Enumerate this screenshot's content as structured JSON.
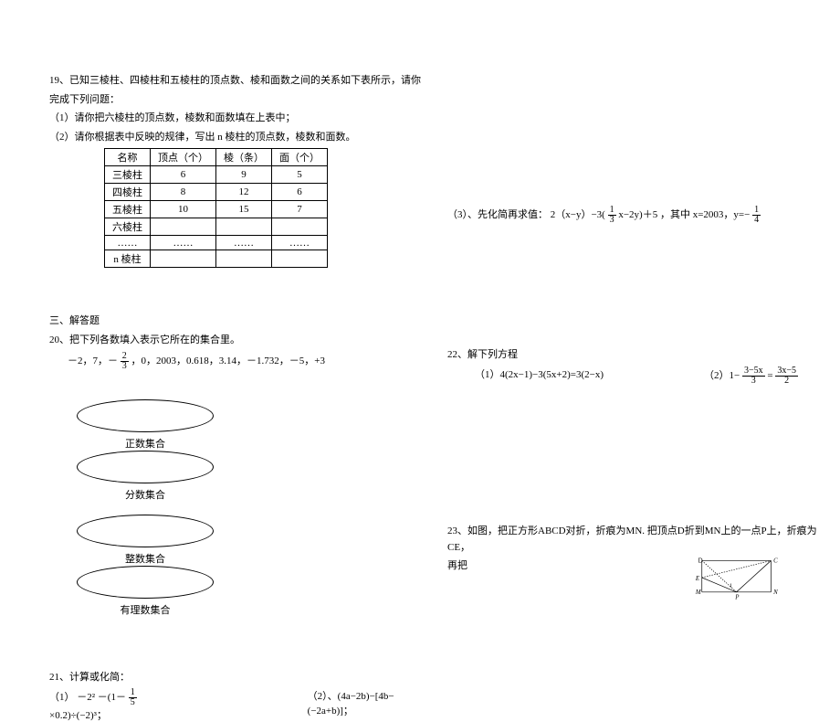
{
  "q19": {
    "title": "19、已知三棱柱、四棱柱和五棱柱的顶点数、棱和面数之间的关系如下表所示，请你",
    "title_line2": "完成下列问题：",
    "sub1": "（1）请你把六棱柱的顶点数，棱数和面数填在上表中；",
    "sub2": "（2）请你根据表中反映的规律，写出 n 棱柱的顶点数，棱数和面数。",
    "table": {
      "headers": [
        "名称",
        "顶点（个）",
        "棱（条）",
        "面（个）"
      ],
      "rows": [
        [
          "三棱柱",
          "6",
          "9",
          "5"
        ],
        [
          "四棱柱",
          "8",
          "12",
          "6"
        ],
        [
          "五棱柱",
          "10",
          "15",
          "7"
        ],
        [
          "六棱柱",
          "",
          "",
          ""
        ],
        [
          "……",
          "……",
          "……",
          "……"
        ],
        [
          "n 棱柱",
          "",
          "",
          ""
        ]
      ]
    }
  },
  "section3": {
    "title": "三、解答题"
  },
  "q20": {
    "title": "20、把下列各数填入表示它所在的集合里。",
    "numbers_prefix": "－2，7，－",
    "numbers_suffix": "，0，2003，0.618，3.14，－1.732，－5，+3",
    "frac_num": "2",
    "frac_den": "3",
    "sets": {
      "pos": "正数集合",
      "frac": "分数集合",
      "int": "整数集合",
      "rat": "有理数集合"
    }
  },
  "q21": {
    "title": "21、计算或化简：",
    "part1": "（1）",
    "part1_expr_before": "－2² －(1－",
    "part1_frac_num": "1",
    "part1_frac_den": "5",
    "part1_expr_after": "×0.2)÷(−2)³；",
    "part2": "（2）、(4a−2b)−[4b−(−2a+b)]；"
  },
  "q3sub": {
    "prefix": "（3）、先化简再求值：  2（x−y）−3(",
    "frac_num": "1",
    "frac_den": "3",
    "middle": "x−2y)＋5  ，其中 x=2003，y=−",
    "frac2_num": "1",
    "frac2_den": "4"
  },
  "q22": {
    "title": "22、解下列方程",
    "part1": "（1）4(2x−1)−3(5x+2)=3(2−x)",
    "part2_prefix": "（2）1−",
    "part2_frac1_num": "3−5x",
    "part2_frac1_den": "3",
    "part2_eq": "=",
    "part2_frac2_num": "3x−5",
    "part2_frac2_den": "2"
  },
  "q23": {
    "line1": "23、如图，把正方形ABCD对折，折痕为MN. 把顶点D折到MN上的一点P上，折痕为CE，",
    "line2": "再把",
    "labels": {
      "D": "D",
      "C": "C",
      "E": "E",
      "M": "M",
      "N": "N",
      "P": "P",
      "one": "1"
    }
  }
}
